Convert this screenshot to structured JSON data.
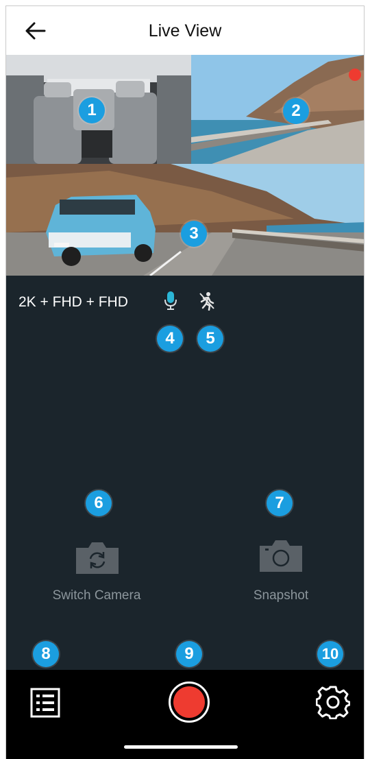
{
  "header": {
    "title": "Live View",
    "back_icon": "arrow-left-icon"
  },
  "feeds": {
    "cabin_label": "1",
    "rear_label": "2",
    "front_label": "3",
    "recording_indicator_color": "#ee3b30"
  },
  "status": {
    "resolution": "2K + FHD + FHD",
    "mic_label": "4",
    "motion_label": "5",
    "mic_icon": "microphone-icon",
    "motion_icon": "motion-detection-off-icon"
  },
  "controls": {
    "switch_camera": {
      "badge": "6",
      "label": "Switch Camera",
      "icon": "switch-camera-icon"
    },
    "snapshot": {
      "badge": "7",
      "label": "Snapshot",
      "icon": "camera-icon"
    }
  },
  "bottom_bar": {
    "list_badge": "8",
    "record_badge": "9",
    "settings_badge": "10",
    "list_icon": "list-icon",
    "record_icon": "record-icon",
    "settings_icon": "gear-icon"
  },
  "colors": {
    "badge": "#1b9ee0",
    "record": "#ee3b30",
    "background": "#1b252c"
  }
}
